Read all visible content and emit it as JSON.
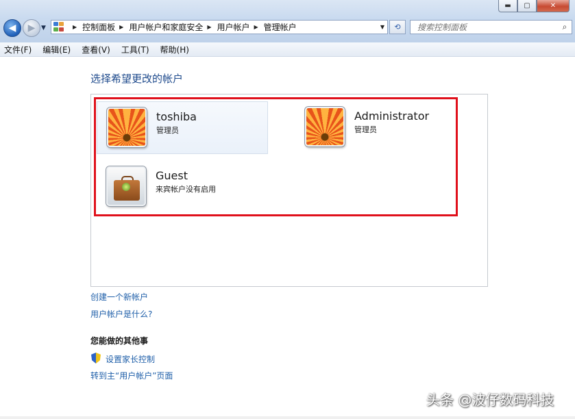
{
  "window": {
    "controls": {
      "minimize": "▬",
      "maximize": "▢",
      "close": "✕"
    }
  },
  "nav": {
    "back_icon": "◀",
    "forward_icon": "▶",
    "dropdown_icon": "▼",
    "breadcrumb": [
      "控制面板",
      "用户帐户和家庭安全",
      "用户帐户",
      "管理帐户"
    ],
    "address_dropdown_icon": "▼",
    "refresh_icon": "⟲",
    "search_placeholder": "搜索控制面板",
    "search_icon": "⌕"
  },
  "menu": [
    "文件(F)",
    "编辑(E)",
    "查看(V)",
    "工具(T)",
    "帮助(H)"
  ],
  "main": {
    "heading": "选择希望更改的帐户",
    "accounts": [
      {
        "name": "toshiba",
        "role": "管理员",
        "picture": "flower"
      },
      {
        "name": "Administrator",
        "role": "管理员",
        "picture": "flower"
      },
      {
        "name": "Guest",
        "role": "来宾帐户没有启用",
        "picture": "briefcase"
      }
    ],
    "links": [
      "创建一个新帐户",
      "用户帐户是什么?"
    ],
    "other_heading": "您能做的其他事",
    "other_links": [
      "设置家长控制",
      "转到主“用户帐户”页面"
    ]
  },
  "watermark": "头条 @波仔数码科技",
  "colors": {
    "link": "#1f5fa9",
    "heading": "#1e4a8c",
    "highlight_box": "#e0101b"
  }
}
